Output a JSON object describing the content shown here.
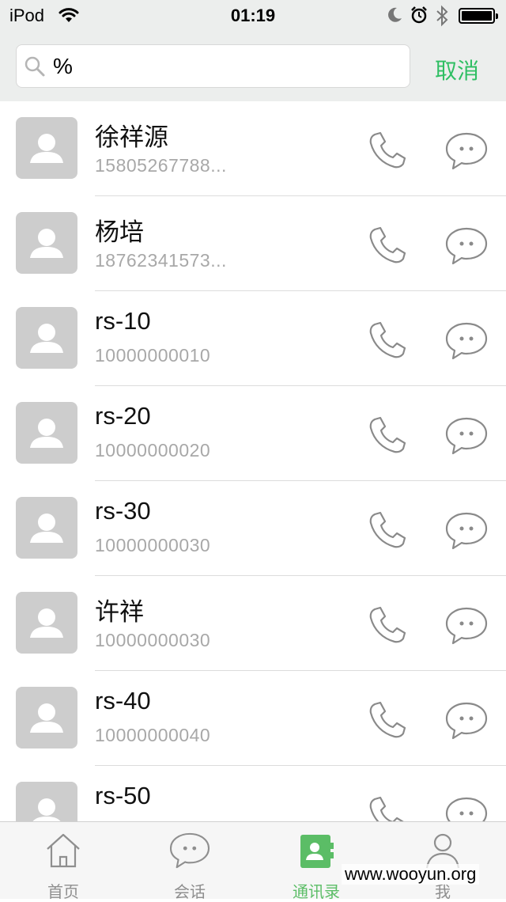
{
  "status_bar": {
    "carrier": "iPod",
    "time": "01:19"
  },
  "search": {
    "value": "%",
    "cancel_label": "取消"
  },
  "contacts": [
    {
      "name": "徐祥源",
      "phone": "15805267788..."
    },
    {
      "name": "杨培",
      "phone": "18762341573..."
    },
    {
      "name": "rs-10",
      "phone": "10000000010"
    },
    {
      "name": "rs-20",
      "phone": "10000000020"
    },
    {
      "name": "rs-30",
      "phone": "10000000030"
    },
    {
      "name": "许祥",
      "phone": "10000000030"
    },
    {
      "name": "rs-40",
      "phone": "10000000040"
    },
    {
      "name": "rs-50",
      "phone": ""
    }
  ],
  "tabs": [
    {
      "label": "首页",
      "icon": "home-icon"
    },
    {
      "label": "会话",
      "icon": "chat-icon"
    },
    {
      "label": "通讯录",
      "icon": "contacts-icon",
      "active": true
    },
    {
      "label": "我",
      "icon": "person-icon"
    }
  ],
  "watermark": "www.wooyun.org",
  "colors": {
    "accent": "#2fbf63",
    "tab_active": "#5bbd66",
    "avatar_bg": "#cdcdcd",
    "secondary_text": "#a8a8a8"
  }
}
